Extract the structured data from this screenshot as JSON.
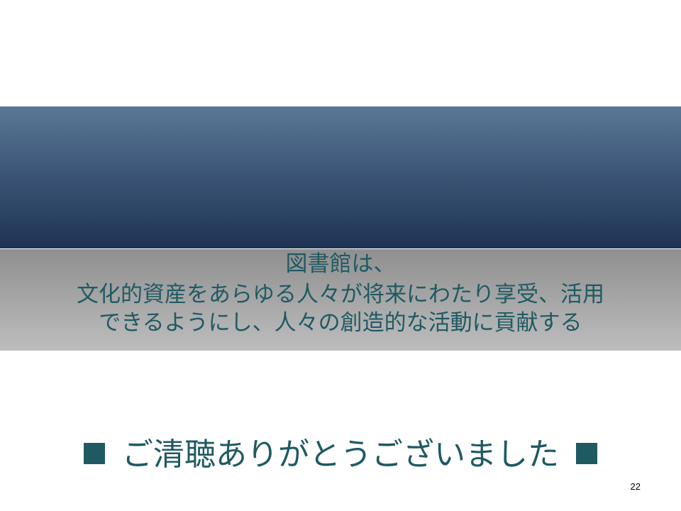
{
  "slide": {
    "mission_lines": [
      "図書館は、",
      "文化的資産をあらゆる人々が将来にわたり享受、活用",
      "できるようにし、人々の創造的な活動に貢献する"
    ],
    "closing_text": "ご清聴ありがとうございました",
    "page_number": "22"
  },
  "colors": {
    "band_top": "#5a7896",
    "band_bottom": "#1f3354",
    "text_teal": "#1f5a63",
    "gray_band": "#a6a6a6"
  }
}
